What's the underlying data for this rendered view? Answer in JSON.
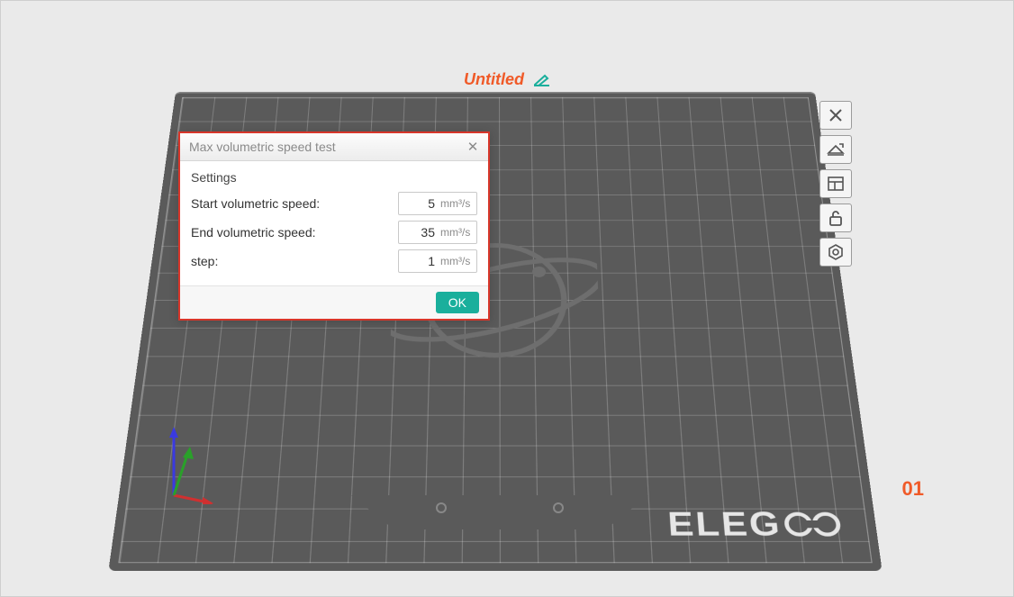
{
  "project": {
    "title": "Untitled"
  },
  "plate": {
    "brand": "ELEG",
    "index": "01"
  },
  "dialog": {
    "title": "Max volumetric speed test",
    "section": "Settings",
    "start_label": "Start volumetric speed:",
    "end_label": "End volumetric speed:",
    "step_label": "step:",
    "start_value": "5",
    "end_value": "35",
    "step_value": "1",
    "unit": "mm³/s",
    "ok_label": "OK"
  },
  "toolbar_icons": {
    "close": "close-icon",
    "plate_type": "plate-type-icon",
    "panel": "panel-layout-icon",
    "lock": "unlock-icon",
    "settings": "hex-settings-icon"
  }
}
